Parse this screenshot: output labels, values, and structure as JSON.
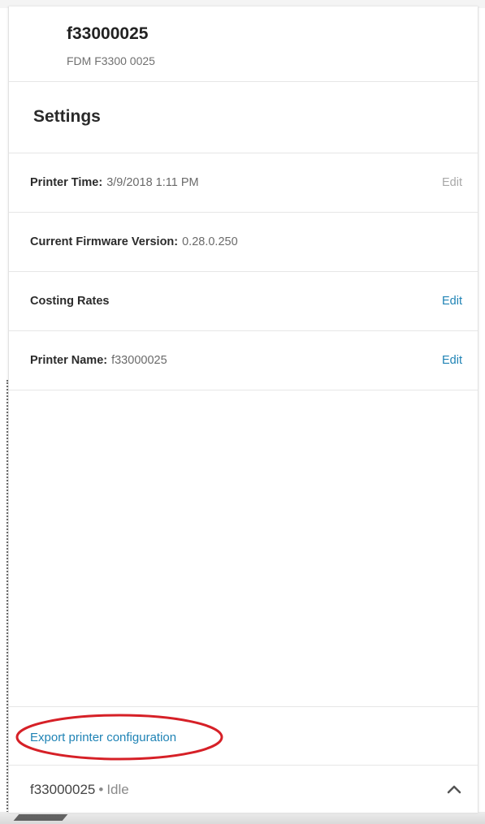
{
  "printer": {
    "id": "f33000025",
    "model": "FDM F3300 0025"
  },
  "settings": {
    "title": "Settings",
    "rows": [
      {
        "label": "Printer Time:",
        "value": "3/9/2018 1:11 PM",
        "edit_label": "Edit",
        "edit_enabled": false
      },
      {
        "label": "Current Firmware Version:",
        "value": "0.28.0.250"
      },
      {
        "label": "Costing Rates",
        "value": "",
        "edit_label": "Edit",
        "edit_enabled": true
      },
      {
        "label": "Printer Name:",
        "value": "f33000025",
        "edit_label": "Edit",
        "edit_enabled": true
      }
    ]
  },
  "footer": {
    "export_label": "Export printer configuration",
    "highlight_color": "#d62027"
  },
  "status_bar": {
    "printer_id": "f33000025",
    "separator": "•",
    "state": "Idle",
    "expand_icon": "chevron-up-icon"
  },
  "colors": {
    "link": "#1f83b5",
    "edit_disabled": "#a8a8a8"
  }
}
